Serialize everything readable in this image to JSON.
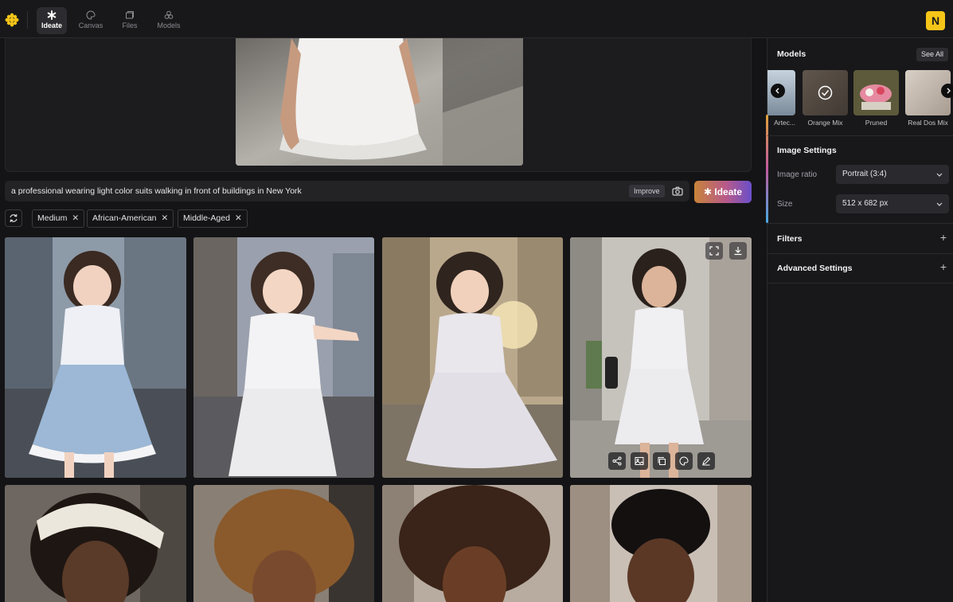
{
  "nav": {
    "items": [
      {
        "label": "Ideate",
        "icon": "asterisk-icon",
        "active": true
      },
      {
        "label": "Canvas",
        "icon": "palette-icon",
        "active": false
      },
      {
        "label": "Files",
        "icon": "folders-icon",
        "active": false
      },
      {
        "label": "Models",
        "icon": "circles-icon",
        "active": false
      }
    ],
    "avatar_letter": "N"
  },
  "prompt": {
    "text": "a professional wearing light color suits walking in front of buildings in New York",
    "improve_label": "Improve",
    "ideate_label": "Ideate"
  },
  "chips": [
    "Medium",
    "African-American",
    "Middle-Aged"
  ],
  "sidebar": {
    "models_title": "Models",
    "see_all_label": "See All",
    "models": [
      {
        "label": "Artec..."
      },
      {
        "label": "Orange Mix",
        "selected": true
      },
      {
        "label": "Pruned"
      },
      {
        "label": "Real Dos Mix"
      }
    ],
    "image_settings_title": "Image Settings",
    "image_ratio_label": "Image ratio",
    "image_ratio_value": "Portrait (3:4)",
    "size_label": "Size",
    "size_value": "512 x 682 px",
    "filters_title": "Filters",
    "advanced_title": "Advanced Settings"
  },
  "colors": {
    "accent": "#f5c518",
    "background": "#18181b"
  }
}
